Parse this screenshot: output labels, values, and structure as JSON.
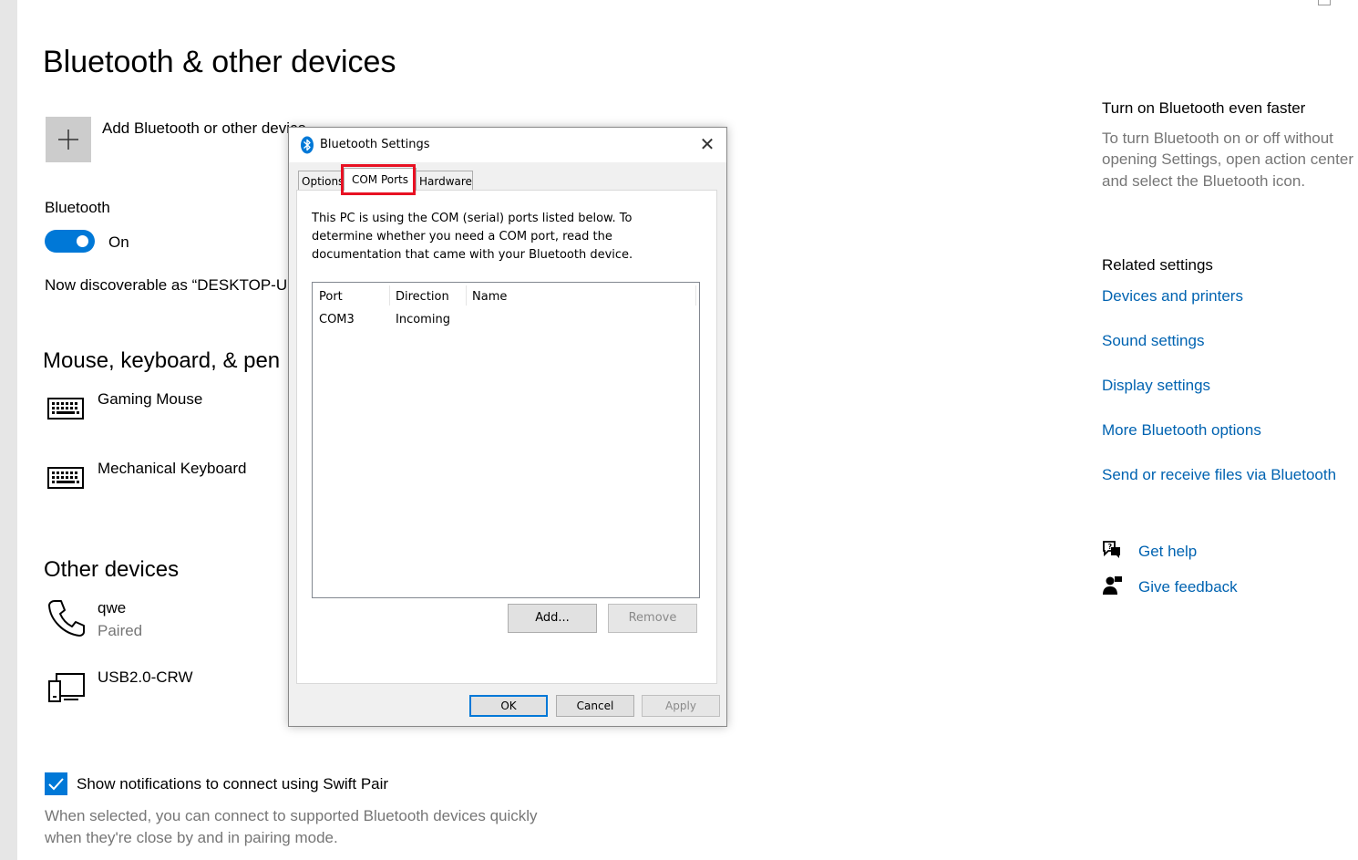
{
  "page": {
    "title": "Bluetooth & other devices",
    "add_device_label": "Add Bluetooth or other device",
    "bluetooth_label": "Bluetooth",
    "bluetooth_state": "On",
    "discoverable_text": "Now discoverable as “DESKTOP-UE",
    "mouse_section": "Mouse, keyboard, & pen",
    "mouse_devices": [
      {
        "name": "Gaming Mouse",
        "icon": "keyboard-icon"
      },
      {
        "name": "Mechanical Keyboard",
        "icon": "keyboard-icon"
      }
    ],
    "other_section": "Other devices",
    "other_devices": [
      {
        "name": "qwe",
        "status": "Paired",
        "icon": "phone-icon"
      },
      {
        "name": "USB2.0-CRW",
        "icon": "device-icon"
      }
    ],
    "swift_pair_label": "Show notifications to connect using Swift Pair",
    "swift_pair_desc_1": "When selected, you can connect to supported Bluetooth devices quickly",
    "swift_pair_desc_2": "when they're close by and in pairing mode."
  },
  "sidebar": {
    "faster_title": "Turn on Bluetooth even faster",
    "faster_desc_1": "To turn Bluetooth on or off without",
    "faster_desc_2": "opening Settings, open action center",
    "faster_desc_3": "and select the Bluetooth icon.",
    "related_title": "Related settings",
    "links": [
      "Devices and printers",
      "Sound settings",
      "Display settings",
      "More Bluetooth options",
      "Send or receive files via Bluetooth"
    ],
    "help": "Get help",
    "feedback": "Give feedback"
  },
  "dialog": {
    "title": "Bluetooth Settings",
    "tabs": [
      "Options",
      "COM Ports",
      "Hardware"
    ],
    "active_tab": "COM Ports",
    "description": "This PC is using the COM (serial) ports listed below. To determine whether you need a COM port, read the documentation that came with your Bluetooth device.",
    "columns": [
      "Port",
      "Direction",
      "Name"
    ],
    "rows": [
      {
        "port": "COM3",
        "direction": "Incoming",
        "name": ""
      }
    ],
    "add_button": "Add...",
    "remove_button": "Remove",
    "ok_button": "OK",
    "cancel_button": "Cancel",
    "apply_button": "Apply"
  },
  "colors": {
    "accent": "#0078d7",
    "link": "#0063b1",
    "highlight": "#e81123"
  }
}
